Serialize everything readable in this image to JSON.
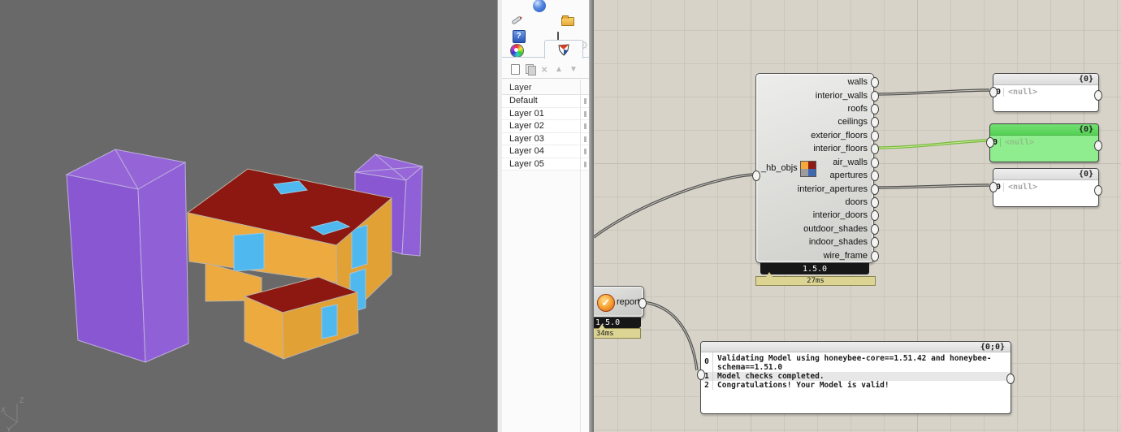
{
  "rhino": {
    "viewport": {
      "axis_labels": {
        "x": "X",
        "y": "Y",
        "z": "Z"
      },
      "objects": [
        "tall-purple-box",
        "small-purple-box",
        "orange-building-upper",
        "orange-building-lower"
      ],
      "colors": {
        "background": "#696969",
        "purple": "#8a57d2",
        "wall_orange": "#edaa3f",
        "roof_red": "#8d1711",
        "window_blue": "#4fb8ee"
      }
    },
    "layers_panel": {
      "tab_icons": [
        "sphere-icon",
        "pencil-icon",
        "folder-icon",
        "help-icon",
        "monitor-icon",
        "colorwheel-icon",
        "layers-shield-icon",
        "gear-icon"
      ],
      "toolbar_icons": [
        "new-layer-icon",
        "copy-layer-icon",
        "delete-layer-icon",
        "move-up-icon",
        "move-down-icon"
      ],
      "help_glyph": "?",
      "delete_glyph": "×",
      "up_glyph": "▲",
      "down_glyph": "▼",
      "gear_glyph": "⚙",
      "column_header": "Layer",
      "layers": [
        "Default",
        "Layer 01",
        "Layer 02",
        "Layer 03",
        "Layer 04",
        "Layer 05"
      ]
    }
  },
  "grasshopper": {
    "hb_component": {
      "input_label": "_hb_objs",
      "outputs": [
        "walls",
        "interior_walls",
        "roofs",
        "ceilings",
        "exterior_floors",
        "interior_floors",
        "air_walls",
        "apertures",
        "interior_apertures",
        "doors",
        "interior_doors",
        "outdoor_shades",
        "indoor_shades",
        "wire_frame"
      ],
      "version": "1.5.0",
      "runtime": "27ms"
    },
    "report_component": {
      "label": "report",
      "check_glyph": "✓",
      "version": "1.5.0",
      "runtime": "34ms"
    },
    "panels": [
      {
        "header": "{0}",
        "index": "0",
        "value": "<null>"
      },
      {
        "header": "{0}",
        "index": "0",
        "value": "<null>"
      },
      {
        "header": "{0}",
        "index": "0",
        "value": "<null>"
      }
    ],
    "message_panel": {
      "header": "{0;0}",
      "rows": [
        {
          "index": "0",
          "lines": [
            "Validating Model using honeybee-core==1.51.42 and honeybee-",
            "schema==1.51.0"
          ]
        },
        {
          "index": "1",
          "lines": [
            "Model checks completed."
          ]
        },
        {
          "index": "2",
          "lines": [
            "Congratulations! Your Model is valid!"
          ]
        }
      ]
    },
    "colors": {
      "selected_green": "#8fec8f",
      "canvas": "#d7d3c8",
      "wire_green": "#76b93c"
    }
  }
}
